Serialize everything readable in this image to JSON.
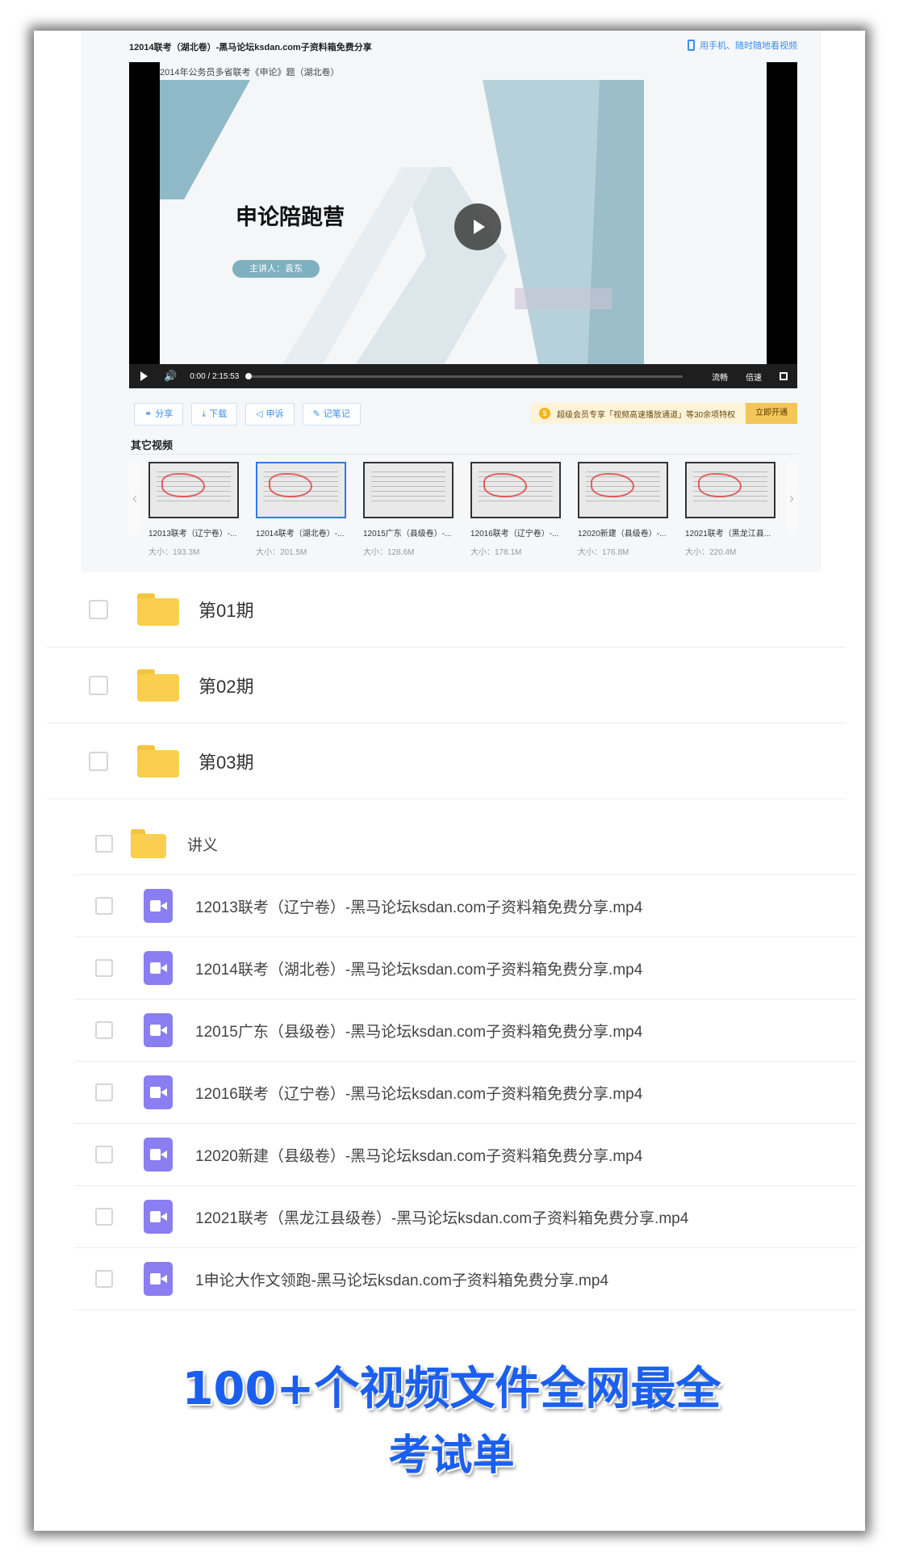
{
  "player": {
    "title": "12014联考（湖北卷）-黑马论坛ksdan.com子资料箱免费分享",
    "mobile_link": "用手机、随时随地看视频",
    "slide_header": "2014年公务员多省联考《申论》题（湖北卷）",
    "slide_title": "申论陪跑营",
    "speaker": "主讲人：袁东",
    "time_current": "0:00",
    "time_sep": "/",
    "time_total": "2:15:53",
    "quality_label": "流畅",
    "speed_label": "倍速"
  },
  "actions": [
    {
      "label": "分享",
      "icon": "share-icon",
      "glyph": "⚭"
    },
    {
      "label": "下载",
      "icon": "download-icon",
      "glyph": "⤓"
    },
    {
      "label": "申诉",
      "icon": "megaphone-icon",
      "glyph": "◁"
    },
    {
      "label": "记笔记",
      "icon": "pencil-icon",
      "glyph": "✎"
    }
  ],
  "vip": {
    "coin": "$",
    "text": "超级会员专享「视频高速播放通道」等30余项特权",
    "button": "立即开通"
  },
  "other_videos": {
    "title": "其它视频",
    "items": [
      {
        "name": "12013联考（辽宁卷）-...",
        "size": "大小：193.3M",
        "active": false
      },
      {
        "name": "12014联考（湖北卷）-...",
        "size": "大小：201.5M",
        "active": true
      },
      {
        "name": "12015广东（县级卷）-...",
        "size": "大小：128.6M",
        "active": false
      },
      {
        "name": "12016联考（辽宁卷）-...",
        "size": "大小：178.1M",
        "active": false
      },
      {
        "name": "12020新建（县级卷）-...",
        "size": "大小：176.8M",
        "active": false
      },
      {
        "name": "12021联考（黑龙江县...",
        "size": "大小：220.4M",
        "active": false
      }
    ]
  },
  "folders_top": [
    {
      "label": "第01期"
    },
    {
      "label": "第02期"
    },
    {
      "label": "第03期"
    }
  ],
  "files_bottom": [
    {
      "type": "folder",
      "label": "讲义"
    },
    {
      "type": "video",
      "label": "12013联考（辽宁卷）-黑马论坛ksdan.com子资料箱免费分享.mp4"
    },
    {
      "type": "video",
      "label": "12014联考（湖北卷）-黑马论坛ksdan.com子资料箱免费分享.mp4"
    },
    {
      "type": "video",
      "label": "12015广东（县级卷）-黑马论坛ksdan.com子资料箱免费分享.mp4"
    },
    {
      "type": "video",
      "label": "12016联考（辽宁卷）-黑马论坛ksdan.com子资料箱免费分享.mp4"
    },
    {
      "type": "video",
      "label": "12020新建（县级卷）-黑马论坛ksdan.com子资料箱免费分享.mp4"
    },
    {
      "type": "video",
      "label": "12021联考（黑龙江县级卷）-黑马论坛ksdan.com子资料箱免费分享.mp4"
    },
    {
      "type": "video",
      "label": "1申论大作文领跑-黑马论坛ksdan.com子资料箱免费分享.mp4"
    }
  ],
  "promo": {
    "line1": "100+个视频文件全网最全",
    "line2": "考试单"
  },
  "colors": {
    "accent": "#3a8ef0",
    "folder": "#f9cf4d",
    "video_icon": "#8b7df2",
    "promo": "#1a5ff0"
  }
}
